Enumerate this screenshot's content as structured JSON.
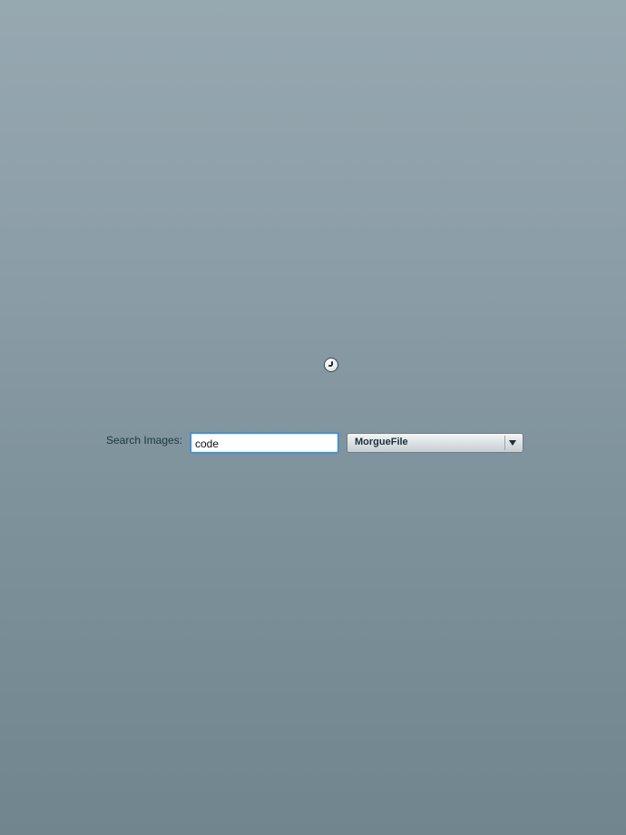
{
  "search": {
    "label": "Search Images:",
    "query_value": "code",
    "placeholder": ""
  },
  "source_select": {
    "selected": "MorgueFile"
  },
  "status": {
    "loading_icon": "spinner-icon"
  },
  "colors": {
    "background_top": "#97a8b1",
    "background_bottom": "#71858f",
    "input_focus_border": "#4f8fc4",
    "label_text": "#1c3540"
  }
}
